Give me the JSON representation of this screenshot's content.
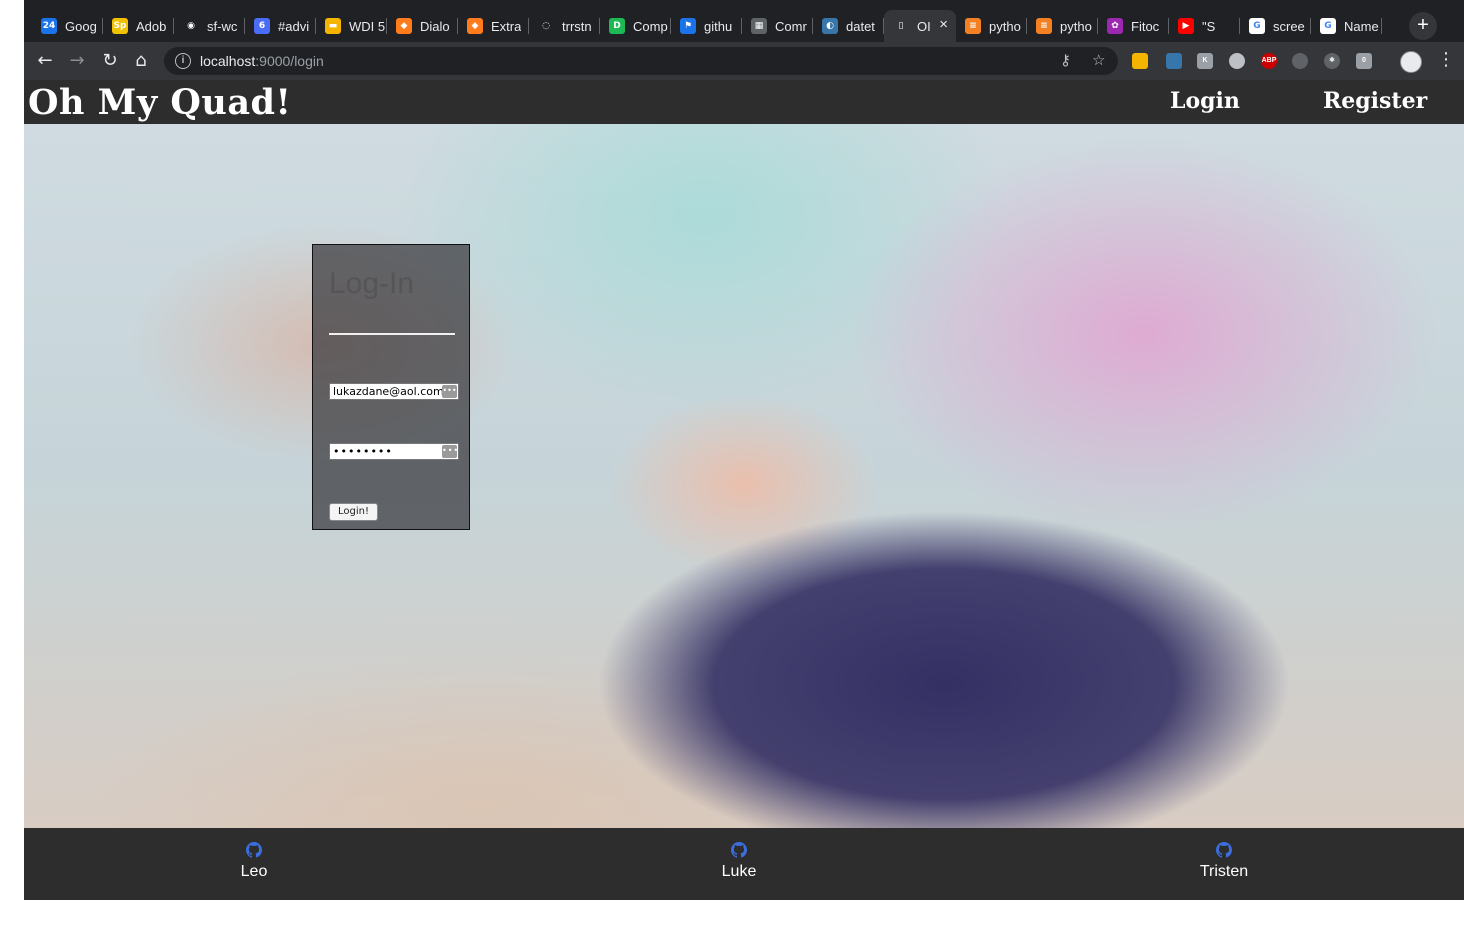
{
  "browser": {
    "tabs": [
      {
        "title": "Goog",
        "icon": "google-calendar-icon",
        "color": "#1a73e8",
        "glyph": "24"
      },
      {
        "title": "Adob",
        "icon": "adobe-spark-icon",
        "color": "#f2c200",
        "glyph": "Sp"
      },
      {
        "title": "sf-wc",
        "icon": "github-icon",
        "color": "#202124",
        "glyph": "◉"
      },
      {
        "title": "#advi",
        "icon": "calendar-badge-icon",
        "color": "#4a6cf7",
        "glyph": "6"
      },
      {
        "title": "WDI 5",
        "icon": "slides-icon",
        "color": "#f4b400",
        "glyph": "▬"
      },
      {
        "title": "Dialo",
        "icon": "sublime-icon",
        "color": "#ff7b1c",
        "glyph": "◆"
      },
      {
        "title": "Extra",
        "icon": "sublime-icon",
        "color": "#ff7b1c",
        "glyph": "◆"
      },
      {
        "title": "trrstn",
        "icon": "loading-icon",
        "color": "#202124",
        "glyph": "◌"
      },
      {
        "title": "Comp",
        "icon": "dash-icon",
        "color": "#1db954",
        "glyph": "D"
      },
      {
        "title": "githu",
        "icon": "flag-icon",
        "color": "#1a73e8",
        "glyph": "⚑"
      },
      {
        "title": "Comr",
        "icon": "grid-icon",
        "color": "#5f6368",
        "glyph": "▦"
      },
      {
        "title": "datet",
        "icon": "python-icon",
        "color": "#3776ab",
        "glyph": "◐"
      },
      {
        "title": "OI",
        "icon": "document-icon",
        "color": "#35363a",
        "glyph": "▯",
        "active": true
      },
      {
        "title": "pytho",
        "icon": "stackoverflow-icon",
        "color": "#f48024",
        "glyph": "≡"
      },
      {
        "title": "pytho",
        "icon": "stackoverflow-icon",
        "color": "#f48024",
        "glyph": "≡"
      },
      {
        "title": "Fitoc",
        "icon": "fitoc-icon",
        "color": "#9c27b0",
        "glyph": "✿"
      },
      {
        "title": "\"S",
        "icon": "youtube-icon",
        "color": "#ff0000",
        "glyph": "▶"
      },
      {
        "title": "scree",
        "icon": "google-icon",
        "color": "#ffffff",
        "glyph": "G"
      },
      {
        "title": "Name",
        "icon": "google-icon",
        "color": "#ffffff",
        "glyph": "G"
      }
    ],
    "url_host": "localhost",
    "url_path": ":9000/login",
    "new_tab": "+"
  },
  "site": {
    "brand": "Oh My Quad!",
    "nav": {
      "login": "Login",
      "register": "Register"
    }
  },
  "login": {
    "title": "Log-In",
    "email_value": "lukazdane@aol.com",
    "password_value": "••••••••",
    "key_glyph": "•••",
    "button": "Login!"
  },
  "footer": {
    "credits": [
      {
        "name": "Leo",
        "icon": "github-icon"
      },
      {
        "name": "Luke",
        "icon": "github-icon"
      },
      {
        "name": "Tristen",
        "icon": "github-icon"
      }
    ],
    "icon_color": "#3b6fe0"
  }
}
